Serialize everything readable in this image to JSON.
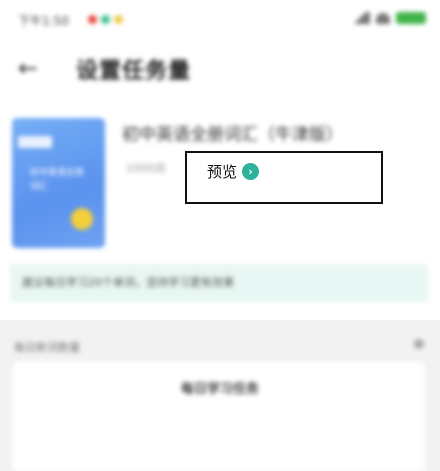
{
  "status_bar": {
    "time": "下午1:50",
    "dot_colors": [
      "#e8453c",
      "#3fbf8f",
      "#f2c94c"
    ]
  },
  "header": {
    "back_icon": "arrow-left-icon",
    "title": "设置任务量"
  },
  "book": {
    "cover_text": "初中英语全册词汇",
    "title": "初中英语全册词汇（牛津版）",
    "meta": "1000词",
    "cover_color": "#5a92ee"
  },
  "preview": {
    "label": "预览",
    "icon": "chevron-right-circle-icon",
    "icon_glyph": "›",
    "icon_color": "#2db19b"
  },
  "notice": {
    "text": "建议每日学习20个单词，坚持学习更有效果",
    "background": "#e8f7f3"
  },
  "settings": {
    "label": "每日新词数量",
    "card_title": "每日学习任务"
  }
}
